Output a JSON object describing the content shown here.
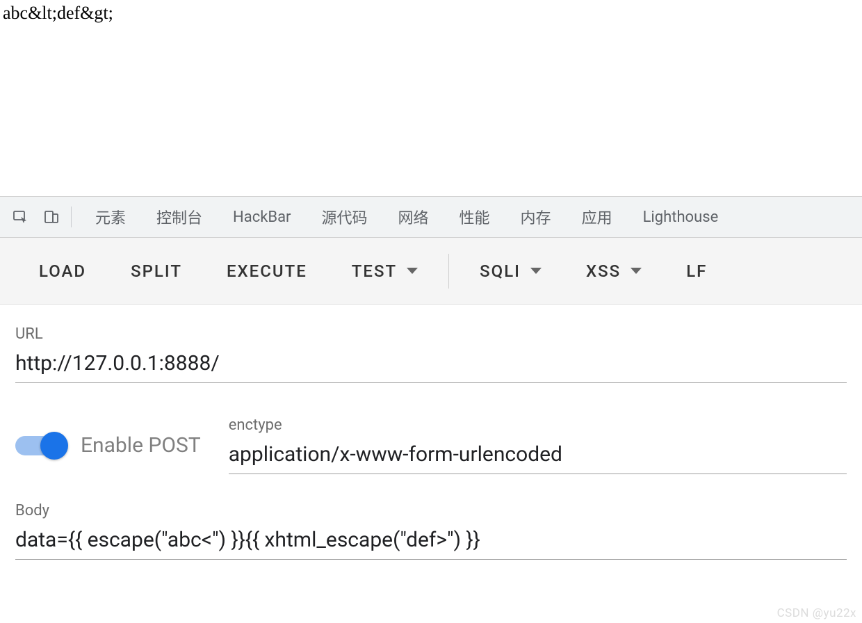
{
  "page": {
    "output": "abc&lt;def&gt;"
  },
  "devtools": {
    "tabs": [
      "元素",
      "控制台",
      "HackBar",
      "源代码",
      "网络",
      "性能",
      "内存",
      "应用",
      "Lighthouse"
    ]
  },
  "hackbar": {
    "buttons": {
      "load": "LOAD",
      "split": "SPLIT",
      "execute": "EXECUTE",
      "test": "TEST",
      "sqli": "SQLI",
      "xss": "XSS",
      "lf": "LF"
    },
    "url": {
      "label": "URL",
      "value": "http://127.0.0.1:8888/"
    },
    "post_toggle": {
      "label": "Enable POST",
      "enabled": true
    },
    "enctype": {
      "label": "enctype",
      "value": "application/x-www-form-urlencoded"
    },
    "body": {
      "label": "Body",
      "value": "data={{ escape(\"abc<\") }}{{ xhtml_escape(\"def>\") }}"
    }
  },
  "watermark": "CSDN @yu22x"
}
